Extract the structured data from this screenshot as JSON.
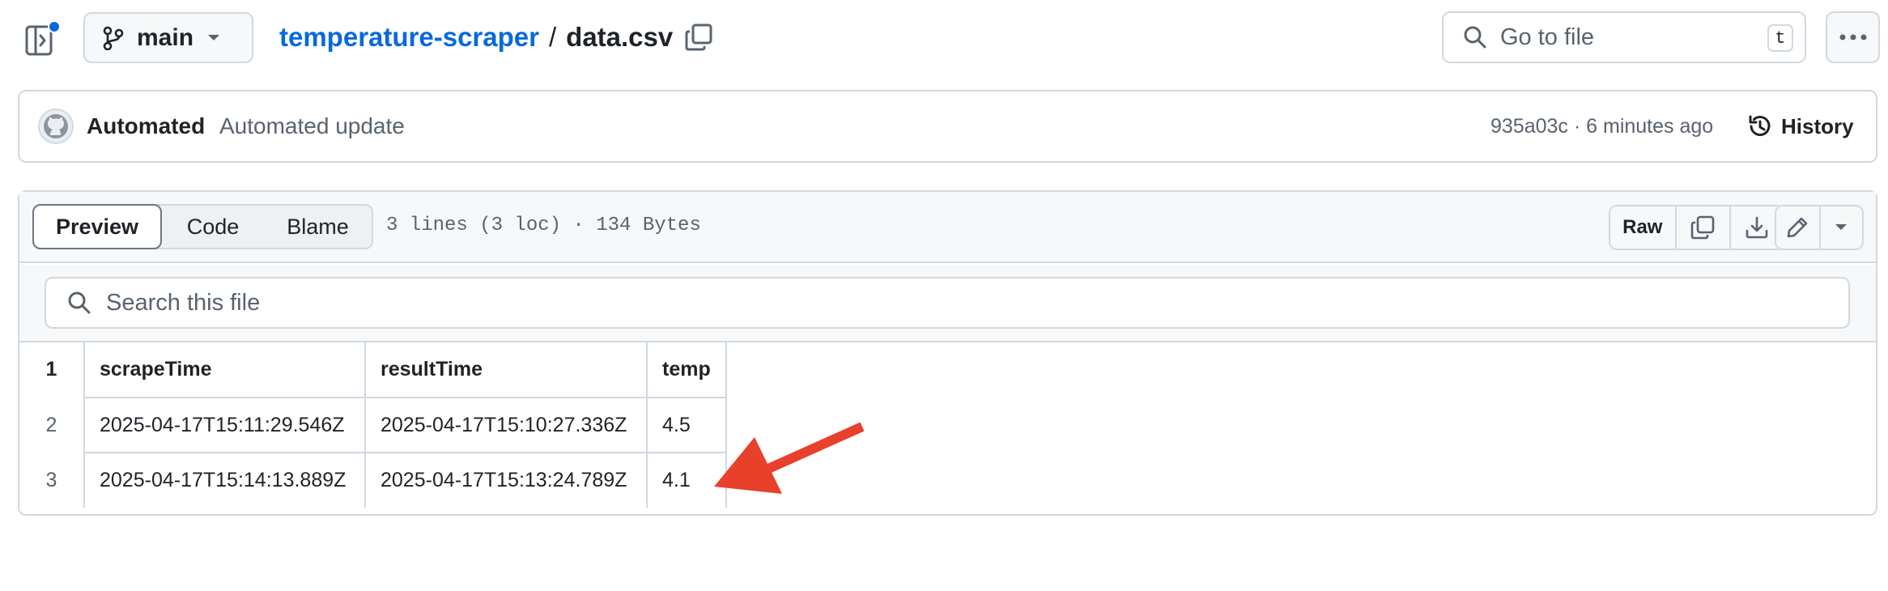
{
  "header": {
    "branch": "main",
    "repo": "temperature-scraper",
    "separator": "/",
    "file": "data.csv",
    "goto_placeholder": "Go to file",
    "goto_shortcut": "t"
  },
  "commit": {
    "author": "Automated",
    "message": "Automated update",
    "meta": "935a03c · 6 minutes ago",
    "history_label": "History"
  },
  "file_view": {
    "tabs": [
      "Preview",
      "Code",
      "Blame"
    ],
    "active_tab": "Preview",
    "info": "3 lines (3 loc) · 134 Bytes",
    "raw_label": "Raw",
    "search_placeholder": "Search this file"
  },
  "csv": {
    "header": {
      "line": "1",
      "cells": [
        "scrapeTime",
        "resultTime",
        "temp"
      ]
    },
    "rows": [
      {
        "line": "2",
        "cells": [
          "2025-04-17T15:11:29.546Z",
          "2025-04-17T15:10:27.336Z",
          "4.5"
        ]
      },
      {
        "line": "3",
        "cells": [
          "2025-04-17T15:14:13.889Z",
          "2025-04-17T15:13:24.789Z",
          "4.1"
        ]
      }
    ]
  },
  "colors": {
    "link": "#0969da",
    "border": "#d1d9e0",
    "notification_dot": "#0969da",
    "annotation_arrow": "#e8402a"
  }
}
